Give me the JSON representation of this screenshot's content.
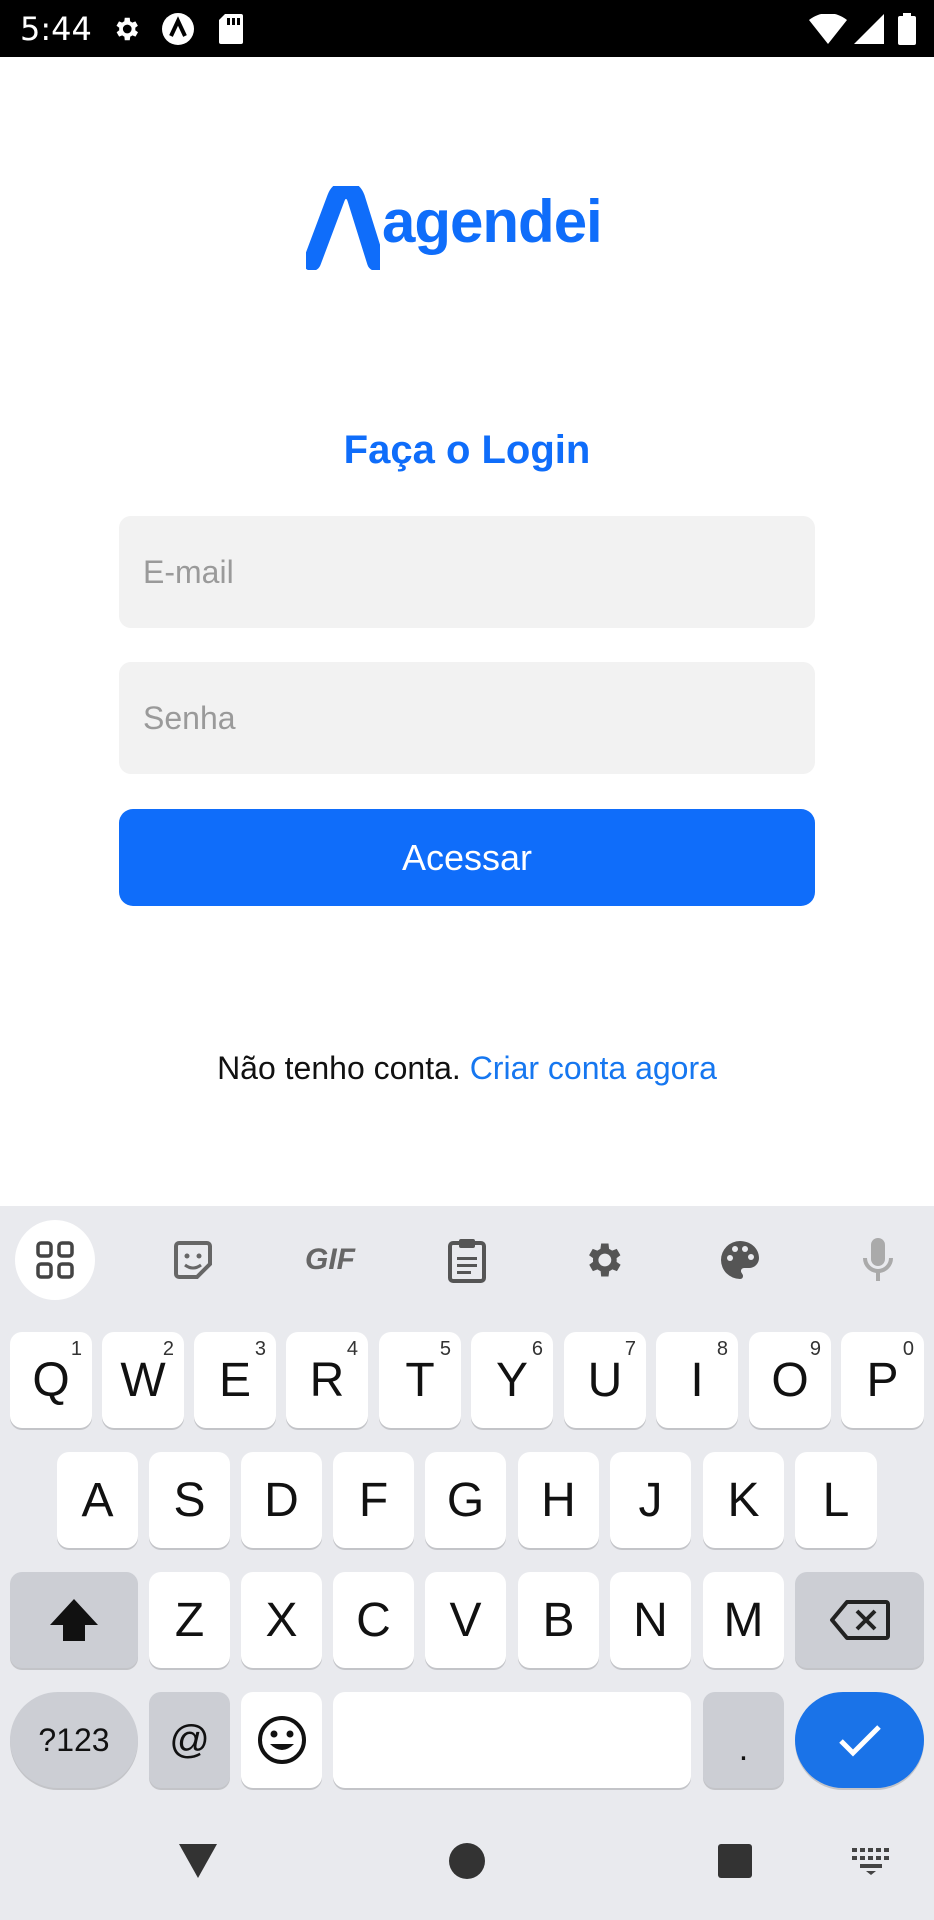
{
  "status_bar": {
    "time": "5:44",
    "icons_left": [
      "gear-icon",
      "a-app-icon",
      "sd-card-icon"
    ],
    "icons_right": [
      "wifi-icon",
      "signal-icon",
      "battery-icon"
    ]
  },
  "brand": {
    "name": "agendei",
    "color": "#0f6dfa"
  },
  "login": {
    "title": "Faça o Login",
    "email_placeholder": "E-mail",
    "password_placeholder": "Senha",
    "submit_label": "Acessar",
    "no_account_text": "Não tenho conta.",
    "create_account_link": "Criar conta agora"
  },
  "keyboard": {
    "toolbar": [
      "apps-grid-icon",
      "sticker-icon",
      "gif-icon",
      "clipboard-icon",
      "settings-icon",
      "palette-icon",
      "mic-icon"
    ],
    "gif_label": "GIF",
    "row1": [
      {
        "key": "Q",
        "hint": "1"
      },
      {
        "key": "W",
        "hint": "2"
      },
      {
        "key": "E",
        "hint": "3"
      },
      {
        "key": "R",
        "hint": "4"
      },
      {
        "key": "T",
        "hint": "5"
      },
      {
        "key": "Y",
        "hint": "6"
      },
      {
        "key": "U",
        "hint": "7"
      },
      {
        "key": "I",
        "hint": "8"
      },
      {
        "key": "O",
        "hint": "9"
      },
      {
        "key": "P",
        "hint": "0"
      }
    ],
    "row2": [
      "A",
      "S",
      "D",
      "F",
      "G",
      "H",
      "J",
      "K",
      "L"
    ],
    "row3": [
      "Z",
      "X",
      "C",
      "V",
      "B",
      "N",
      "M"
    ],
    "symbols_label": "?123",
    "at_label": "@",
    "period_label": ".",
    "accent_color": "#1a73e8"
  },
  "nav_bar": [
    "back-icon",
    "home-icon",
    "recents-icon",
    "keyboard-switch-icon"
  ]
}
